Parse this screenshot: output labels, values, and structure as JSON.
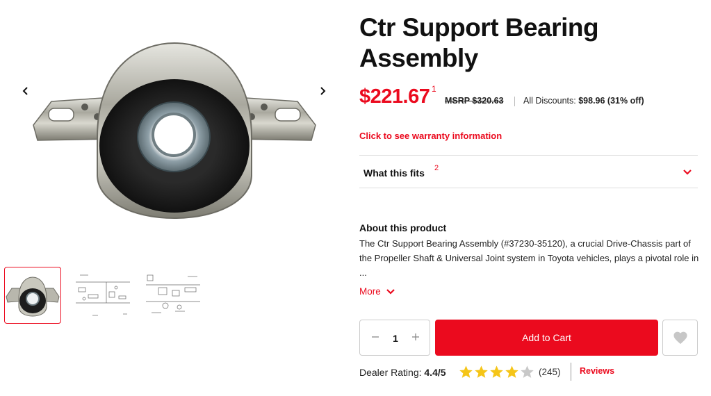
{
  "product": {
    "title": "Ctr Support Bearing Assembly",
    "price": "$221.67",
    "price_footnote": "1",
    "msrp": "MSRP $320.63",
    "discount_label": "All Discounts:",
    "discount_value": "$98.96 (31% off)",
    "warranty_link": "Click to see warranty information",
    "fits_label": "What this fits",
    "fits_footnote": "2",
    "about_title": "About this product",
    "about_text": "The Ctr Support Bearing Assembly (#37230-35120), a crucial Drive-Chassis part of the Propeller Shaft & Universal Joint system in Toyota vehicles, plays a pivotal role in ...",
    "more_label": "More"
  },
  "gallery": {
    "thumbnail_count": 3,
    "active_index": 0
  },
  "cart": {
    "quantity": "1",
    "add_to_cart_label": "Add to Cart"
  },
  "rating": {
    "label": "Dealer Rating:",
    "value": "4.4/5",
    "score": 4.4,
    "max": 5,
    "count": "(245)",
    "reviews_label": "Reviews"
  },
  "colors": {
    "accent": "#eb0a1e",
    "star_filled": "#f5c518",
    "star_empty": "#c8c8c8"
  },
  "icons": {
    "prev": "chevron-left-icon",
    "next": "chevron-right-icon",
    "expand": "chevron-down-icon",
    "minus": "minus-icon",
    "plus": "plus-icon",
    "wishlist": "heart-icon",
    "star": "star-icon"
  }
}
